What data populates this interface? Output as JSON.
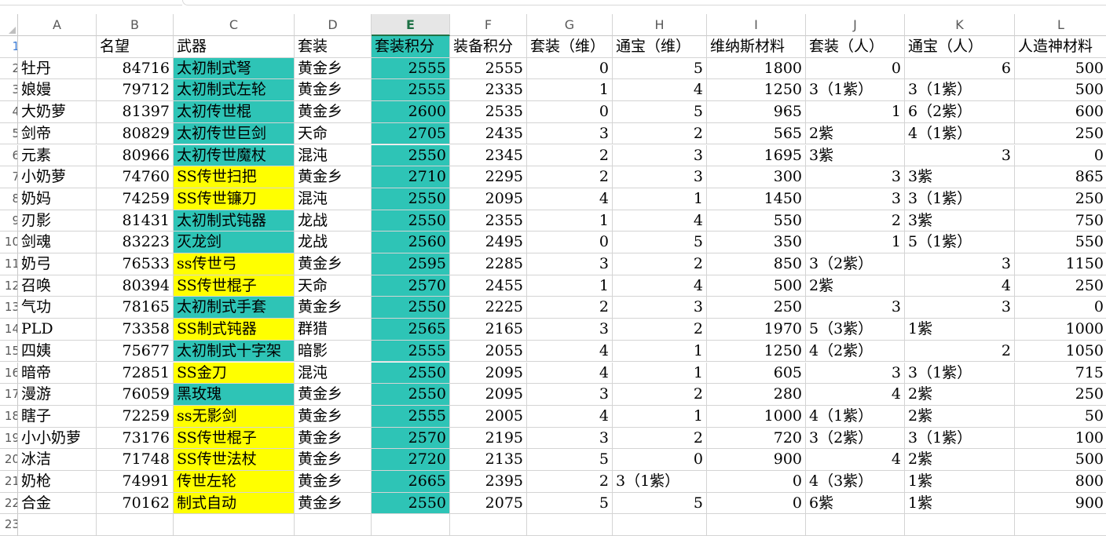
{
  "colors": {
    "teal": "#2ec4b6",
    "yellow": "#ffff00",
    "selected_header_bg": "#e6e6e6",
    "selected_header_text": "#1e7145",
    "gridline": "#d4d4d4"
  },
  "columns": [
    "A",
    "B",
    "C",
    "D",
    "E",
    "F",
    "G",
    "H",
    "I",
    "J",
    "K",
    "L"
  ],
  "selected_column": "E",
  "row_numbers": [
    "1",
    "2",
    "3",
    "4",
    "5",
    "6",
    "7",
    "8",
    "9",
    "10",
    "11",
    "12",
    "13",
    "14",
    "15",
    "16",
    "17",
    "18",
    "19",
    "20",
    "21",
    "22",
    "23"
  ],
  "header_row": [
    "",
    "名望",
    "武器",
    "套装",
    "套装积分",
    "装备积分",
    "套装（维）",
    "通宝（维）",
    "维纳斯材料",
    "套装（人）",
    "通宝（人）",
    "人造神材料"
  ],
  "rows": [
    {
      "cells": [
        "牡丹",
        "84716",
        "太初制式弩",
        "黄金乡",
        "2555",
        "2555",
        "0",
        "5",
        "1800",
        "0",
        "6",
        "500"
      ],
      "weapon_fill": "teal"
    },
    {
      "cells": [
        "娘嫚",
        "79712",
        "太初制式左轮",
        "黄金乡",
        "2555",
        "2335",
        "1",
        "4",
        "1250",
        "3（1紫）",
        "3（1紫）",
        "500"
      ],
      "weapon_fill": "teal"
    },
    {
      "cells": [
        "大奶萝",
        "81397",
        "太初传世棍",
        "黄金乡",
        "2600",
        "2535",
        "0",
        "5",
        "965",
        "1",
        "6（2紫）",
        "600"
      ],
      "weapon_fill": "teal"
    },
    {
      "cells": [
        "剑帝",
        "80829",
        "太初传世巨剑",
        "天命",
        "2705",
        "2435",
        "3",
        "2",
        "565",
        "2紫",
        "4（1紫）",
        "250"
      ],
      "weapon_fill": "teal"
    },
    {
      "cells": [
        "元素",
        "80966",
        "太初传世魔杖",
        "混沌",
        "2550",
        "2345",
        "2",
        "3",
        "1695",
        "3紫",
        "3",
        "0"
      ],
      "weapon_fill": "teal"
    },
    {
      "cells": [
        "小奶萝",
        "74760",
        "SS传世扫把",
        "黄金乡",
        "2710",
        "2295",
        "2",
        "3",
        "300",
        "3",
        "3紫",
        "865"
      ],
      "weapon_fill": "yellow"
    },
    {
      "cells": [
        "奶妈",
        "74259",
        "SS传世镰刀",
        "混沌",
        "2550",
        "2095",
        "4",
        "1",
        "1450",
        "3",
        "3（1紫）",
        "250"
      ],
      "weapon_fill": "yellow"
    },
    {
      "cells": [
        "刃影",
        "81431",
        "太初制式钝器",
        "龙战",
        "2550",
        "2355",
        "1",
        "4",
        "550",
        "2",
        "3紫",
        "750"
      ],
      "weapon_fill": "teal"
    },
    {
      "cells": [
        "剑魂",
        "83223",
        "灭龙剑",
        "龙战",
        "2560",
        "2495",
        "0",
        "5",
        "350",
        "1",
        "5（1紫）",
        "550"
      ],
      "weapon_fill": "teal"
    },
    {
      "cells": [
        "奶弓",
        "76533",
        "ss传世弓",
        "黄金乡",
        "2595",
        "2285",
        "3",
        "2",
        "850",
        "3（2紫）",
        "3",
        "1150"
      ],
      "weapon_fill": "yellow"
    },
    {
      "cells": [
        "召唤",
        "80394",
        "SS传世棍子",
        "天命",
        "2570",
        "2455",
        "1",
        "4",
        "500",
        "2紫",
        "4",
        "250"
      ],
      "weapon_fill": "yellow"
    },
    {
      "cells": [
        "气功",
        "78165",
        "太初制式手套",
        "黄金乡",
        "2550",
        "2225",
        "2",
        "3",
        "250",
        "3",
        "3",
        "0"
      ],
      "weapon_fill": "teal"
    },
    {
      "cells": [
        "PLD",
        "73358",
        "SS制式钝器",
        "群猎",
        "2565",
        "2165",
        "3",
        "2",
        "1970",
        "5（3紫）",
        "1紫",
        "1000"
      ],
      "weapon_fill": "yellow"
    },
    {
      "cells": [
        "四姨",
        "75677",
        "太初制式十字架",
        "暗影",
        "2555",
        "2055",
        "4",
        "1",
        "1250",
        "4（2紫）",
        "2",
        "1050"
      ],
      "weapon_fill": "teal"
    },
    {
      "cells": [
        "暗帝",
        "72851",
        "SS金刀",
        "混沌",
        "2550",
        "2095",
        "4",
        "1",
        "605",
        "3",
        "3（1紫）",
        "715"
      ],
      "weapon_fill": "yellow"
    },
    {
      "cells": [
        "漫游",
        "76059",
        "黑玫瑰",
        "黄金乡",
        "2550",
        "2095",
        "3",
        "2",
        "280",
        "4",
        "2紫",
        "250"
      ],
      "weapon_fill": "teal"
    },
    {
      "cells": [
        "瞎子",
        "72259",
        "ss无影剑",
        "黄金乡",
        "2555",
        "2005",
        "4",
        "1",
        "1000",
        "4（1紫）",
        "2紫",
        "50"
      ],
      "weapon_fill": "yellow"
    },
    {
      "cells": [
        "小小奶萝",
        "73176",
        "SS传世棍子",
        "黄金乡",
        "2570",
        "2195",
        "3",
        "2",
        "720",
        "3（2紫）",
        "3（1紫）",
        "100"
      ],
      "weapon_fill": "yellow"
    },
    {
      "cells": [
        "冰洁",
        "71748",
        "SS传世法杖",
        "黄金乡",
        "2720",
        "2135",
        "5",
        "0",
        "900",
        "4",
        "2紫",
        "500"
      ],
      "weapon_fill": "yellow"
    },
    {
      "cells": [
        "奶枪",
        "74991",
        "传世左轮",
        "黄金乡",
        "2665",
        "2395",
        "2",
        "3（1紫）",
        "0",
        "4（3紫）",
        "1紫",
        "800"
      ],
      "weapon_fill": "yellow"
    },
    {
      "cells": [
        "合金",
        "70162",
        "制式自动",
        "黄金乡",
        "2550",
        "2075",
        "5",
        "5",
        "0",
        "6紫",
        "1紫",
        "900"
      ],
      "weapon_fill": "yellow"
    }
  ]
}
